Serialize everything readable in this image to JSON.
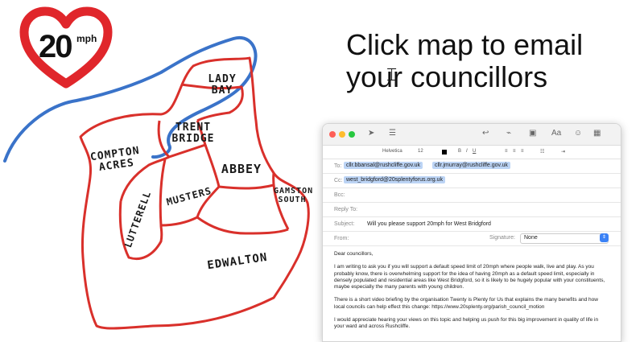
{
  "badge": {
    "speed": "20",
    "unit": "mph"
  },
  "headline": {
    "line1": "Click map to email",
    "line2": "your councillors"
  },
  "map": {
    "areas": [
      {
        "label": "LADY BAY"
      },
      {
        "label": "TRENT BRIDGE"
      },
      {
        "label": "COMPTON ACRES"
      },
      {
        "label": "ABBEY"
      },
      {
        "label": "GAMSTON SOUTH"
      },
      {
        "label": "MUSTERS"
      },
      {
        "label": "LUTTERELL"
      },
      {
        "label": "EDWALTON"
      }
    ],
    "colors": {
      "boundary": "#d9302b",
      "river": "#3a73c9"
    }
  },
  "email": {
    "toolbar": {
      "font": "Helvetica",
      "size": "12",
      "aa": "Aa"
    },
    "to_label": "To:",
    "to": [
      "cllr.bbansal@rushcliffe.gov.uk",
      "cllr.jmurray@rushcliffe.gov.uk"
    ],
    "cc_label": "Cc:",
    "cc": [
      "west_bridgford@20splentyforus.org.uk"
    ],
    "bcc_label": "Bcc:",
    "replyto_label": "Reply To:",
    "subject_label": "Subject:",
    "subject": "Will you please support 20mph for West Bridgford",
    "from_label": "From:",
    "signature_label": "Signature:",
    "signature_value": "None",
    "body": [
      "Dear councillors,",
      "I am writing to ask you if you will support a default speed limit of 20mph where people walk, live and play. As you probably know, there is overwhelming support for the idea of having 20mph as a default speed limit, especially in densely populated and residential areas like West Bridgford, so it is likely to be hugely popular with your constituents, maybe especially the many parents with young children.",
      "There is a short video briefing by the organisation Twenty is Plenty for Us that explains the many benefits and how local councils can help effect this change: https://www.20splenty.org/parish_council_motion",
      "I would appreciate hearing your views on this topic and helping us push for this big improvement in quality of life in your ward and across Rushcliffe."
    ]
  }
}
